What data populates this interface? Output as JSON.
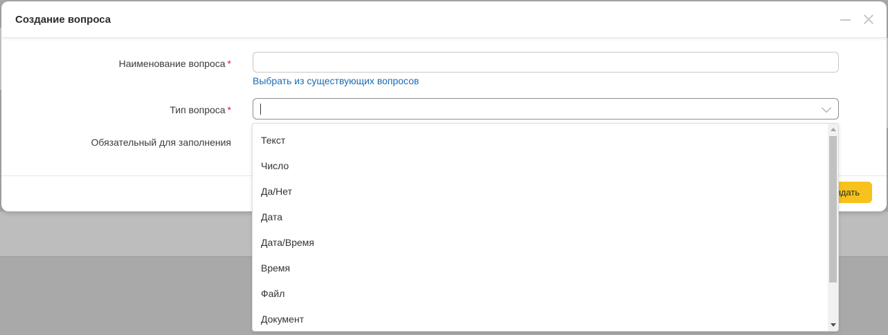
{
  "modal": {
    "title": "Создание вопроса",
    "minimize_icon": "minimize-icon",
    "close_icon": "close-icon"
  },
  "form": {
    "question_name": {
      "label": "Наименование вопроса",
      "required_mark": "*",
      "value": "",
      "placeholder": ""
    },
    "choose_existing_link": "Выбрать из существующих вопросов",
    "question_type": {
      "label": "Тип вопроса",
      "required_mark": "*",
      "value": ""
    },
    "mandatory": {
      "label": "Обязательный для заполнения"
    }
  },
  "footer": {
    "create_label": "оздать",
    "accent_color": "#f7c21b"
  },
  "dropdown": {
    "options": [
      "Текст",
      "Число",
      "Да/Нет",
      "Дата",
      "Дата/Время",
      "Время",
      "Файл",
      "Документ"
    ]
  },
  "colors": {
    "link": "#1a6bb3",
    "required": "#e0162b"
  }
}
